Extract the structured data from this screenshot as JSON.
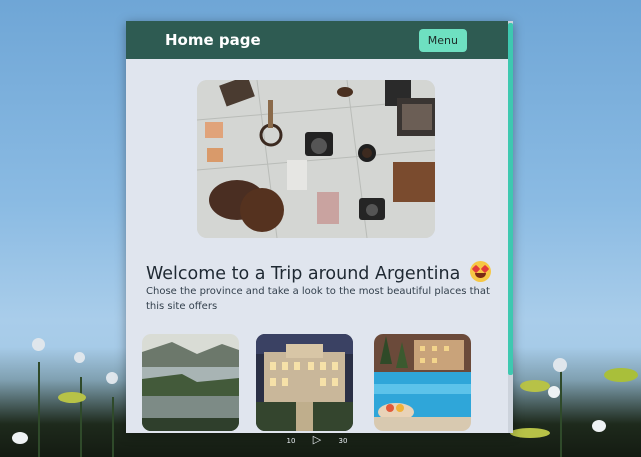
{
  "header": {
    "title": "Home page",
    "menu_label": "Menu"
  },
  "main": {
    "welcome_title": "Welcome to a Trip around Argentina",
    "welcome_subtitle": "Chose the province and take a look to the most beautiful places that this site offers",
    "hero_icon": "travel-flatlay-photo",
    "cards": [
      {
        "icon": "lake-landscape-photo"
      },
      {
        "icon": "palace-building-photo"
      },
      {
        "icon": "pool-resort-photo"
      }
    ]
  },
  "player": {
    "rewind_label": "10",
    "play_icon": "play-icon",
    "forward_label": "30"
  },
  "colors": {
    "header_bg": "#2e5b52",
    "menu_bg": "#6ee0c1",
    "panel_bg": "#e0e5ee",
    "scroll_accent": "#3ec8b0"
  }
}
